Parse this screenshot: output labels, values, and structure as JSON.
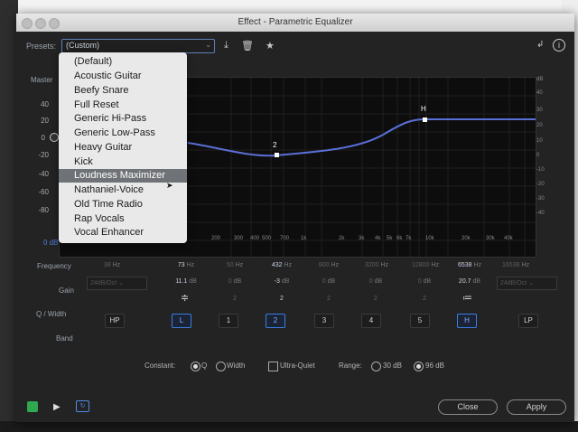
{
  "window": {
    "title": "Effect - Parametric Equalizer"
  },
  "presets": {
    "label": "Presets:",
    "value": "(Custom)"
  },
  "toolbar": {
    "icons": [
      "save-preset-icon",
      "delete-preset-icon",
      "favorite-star-icon",
      "routing-icon",
      "info-icon"
    ]
  },
  "graph": {
    "master_label": "Master",
    "left_scale": [
      "40",
      "20",
      "0",
      "-20",
      "-40",
      "-60",
      "-80"
    ],
    "right_scale": [
      "dB",
      "40",
      "30",
      "20",
      "10",
      "0",
      "-10",
      "-20",
      "-30",
      "-40"
    ],
    "freq_axis": [
      "200",
      "300",
      "400",
      "500",
      "700",
      "1k",
      "2k",
      "3k",
      "4k",
      "5k",
      "6k",
      "7k",
      "10k",
      "20k",
      "30k",
      "40k"
    ],
    "point_labels": {
      "p2": "2",
      "pH": "H"
    },
    "zero_db": "0 dB"
  },
  "presets_dropdown": {
    "items": [
      "(Default)",
      "Acoustic Guitar",
      "Beefy Snare",
      "Full Reset",
      "Generic Hi-Pass",
      "Generic Low-Pass",
      "Heavy Guitar",
      "Kick",
      "Loudness Maximizer",
      "Nathaniel-Voice",
      "Old Time Radio",
      "Rap Vocals",
      "Vocal Enhancer"
    ],
    "highlighted": "Loudness Maximizer"
  },
  "bands": {
    "row_labels": {
      "frequency": "Frequency",
      "gain": "Gain",
      "q_width": "Q / Width",
      "band": "Band"
    },
    "frequency": [
      {
        "value": "38",
        "unit": "Hz"
      },
      {
        "value": "73",
        "unit": "Hz"
      },
      {
        "value": "50",
        "unit": "Hz"
      },
      {
        "value": "432",
        "unit": "Hz"
      },
      {
        "value": "800",
        "unit": "Hz"
      },
      {
        "value": "3200",
        "unit": "Hz"
      },
      {
        "value": "12800",
        "unit": "Hz"
      },
      {
        "value": "6538",
        "unit": "Hz"
      },
      {
        "value": "16538",
        "unit": "Hz"
      }
    ],
    "gain": [
      {
        "value": "24dB/Oct",
        "unit": ""
      },
      {
        "value": "11.1",
        "unit": "dB"
      },
      {
        "value": "0",
        "unit": "dB"
      },
      {
        "value": "-3",
        "unit": "dB"
      },
      {
        "value": "0",
        "unit": "dB"
      },
      {
        "value": "0",
        "unit": "dB"
      },
      {
        "value": "0",
        "unit": "dB"
      },
      {
        "value": "20.7",
        "unit": "dB"
      },
      {
        "value": "24dB/Oct",
        "unit": ""
      }
    ],
    "q": [
      "",
      "",
      "2",
      "2",
      "2",
      "2",
      "2",
      "",
      ""
    ],
    "buttons": [
      "HP",
      "L",
      "1",
      "2",
      "3",
      "4",
      "5",
      "H",
      "LP"
    ]
  },
  "bottom": {
    "constant_label": "Constant:",
    "q_label": "Q",
    "width_label": "Width",
    "ultra_quiet": "Ultra-Quiet",
    "range_label": "Range:",
    "range_30": "30 dB",
    "range_96": "96 dB"
  },
  "footer": {
    "close": "Close",
    "apply": "Apply"
  }
}
